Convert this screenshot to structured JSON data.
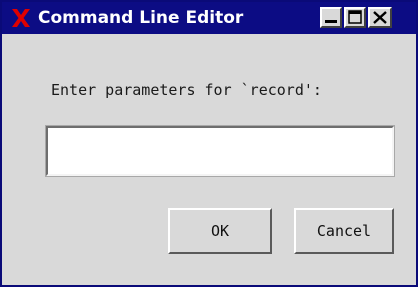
{
  "window": {
    "title": "Command Line Editor",
    "icon": "x-app-icon",
    "controls": [
      "minimize-icon",
      "maximize-icon",
      "close-icon"
    ],
    "titlebar_color": "#0c0c84",
    "icon_color": "#e00000"
  },
  "dialog": {
    "prompt": "Enter parameters for `record':",
    "input_value": "",
    "ok_label": "OK",
    "cancel_label": "Cancel"
  }
}
